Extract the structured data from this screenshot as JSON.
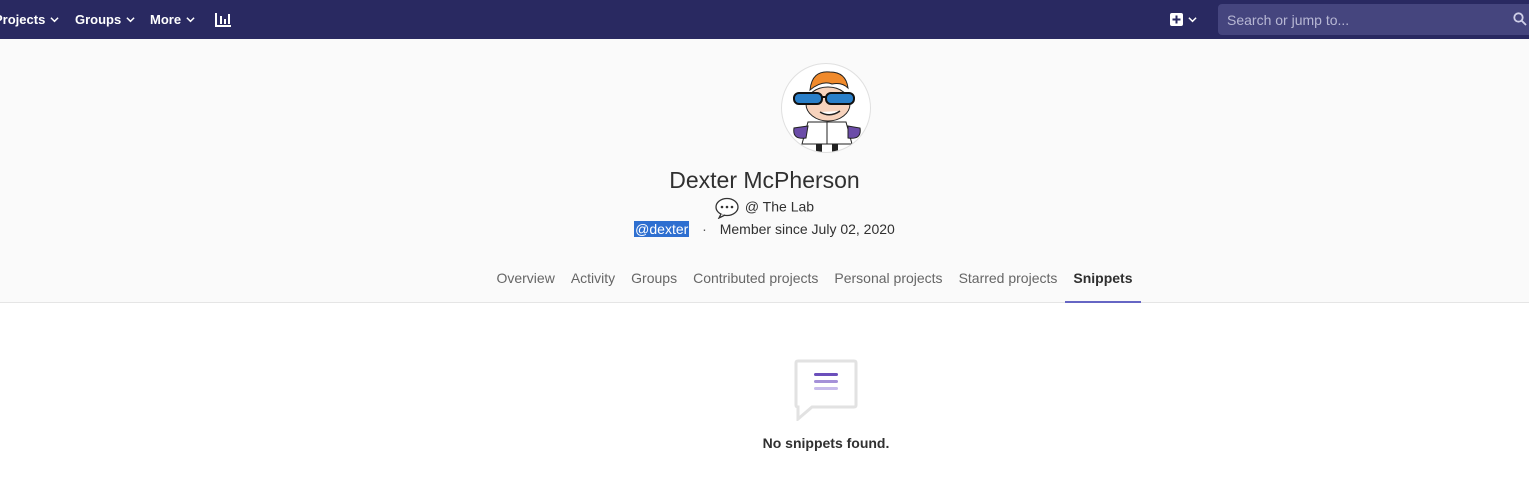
{
  "navbar": {
    "projects_label": "Projects",
    "groups_label": "Groups",
    "more_label": "More",
    "analytics_icon": "chart-bar-icon",
    "new_icon": "plus-square-icon",
    "search_placeholder": "Search or jump to..."
  },
  "profile": {
    "name": "Dexter McPherson",
    "status_emoji": "speech-balloon-icon",
    "status_text": "@ The Lab",
    "username": "@dexter",
    "member_since": "Member since July 02, 2020",
    "separator": "·"
  },
  "tabs": [
    {
      "label": "Overview",
      "active": false
    },
    {
      "label": "Activity",
      "active": false
    },
    {
      "label": "Groups",
      "active": false
    },
    {
      "label": "Contributed projects",
      "active": false
    },
    {
      "label": "Personal projects",
      "active": false
    },
    {
      "label": "Starred projects",
      "active": false
    },
    {
      "label": "Snippets",
      "active": true
    }
  ],
  "empty_state": {
    "message": "No snippets found.",
    "icon": "snippet-empty-icon"
  },
  "colors": {
    "navbar": "#292961",
    "accent": "#6666c4",
    "selection": "#2e6fd0"
  }
}
